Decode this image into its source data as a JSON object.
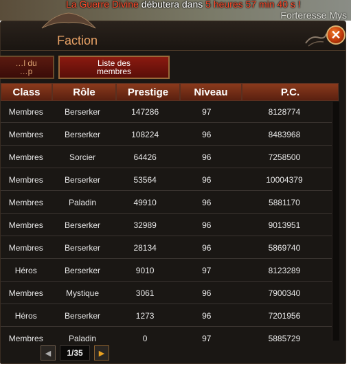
{
  "announcement": {
    "name": "La Guerre Divine",
    "text": "débutera dans",
    "time": "5 heures 57 min 40 s",
    "suffix": "!"
  },
  "background": {
    "place": "Forteresse Mys"
  },
  "window": {
    "title": "Faction",
    "close_symbol": "✕"
  },
  "tabs": [
    {
      "label": "…l du\n…p"
    },
    {
      "label": "Liste des\nmembres",
      "active": true
    }
  ],
  "table": {
    "columns": [
      "Class",
      "Rôle",
      "Prestige",
      "Niveau",
      "P.C."
    ],
    "rows": [
      [
        "Membres",
        "Berserker",
        "147286",
        "97",
        "8128774"
      ],
      [
        "Membres",
        "Berserker",
        "108224",
        "96",
        "8483968"
      ],
      [
        "Membres",
        "Sorcier",
        "64426",
        "96",
        "7258500"
      ],
      [
        "Membres",
        "Berserker",
        "53564",
        "96",
        "10004379"
      ],
      [
        "Membres",
        "Paladin",
        "49910",
        "96",
        "5881170"
      ],
      [
        "Membres",
        "Berserker",
        "32989",
        "96",
        "9013951"
      ],
      [
        "Membres",
        "Berserker",
        "28134",
        "96",
        "5869740"
      ],
      [
        "Héros",
        "Berserker",
        "9010",
        "97",
        "8123289"
      ],
      [
        "Membres",
        "Mystique",
        "3061",
        "96",
        "7900340"
      ],
      [
        "Héros",
        "Berserker",
        "1273",
        "96",
        "7201956"
      ],
      [
        "Membres",
        "Paladin",
        "0",
        "97",
        "5885729"
      ]
    ]
  },
  "pager": {
    "page": "1/35",
    "prev_icon": "◀",
    "next_icon": "▶"
  },
  "colors": {
    "accent": "#e8a266",
    "header": "#8a3a1c",
    "panel": "#1a1714"
  }
}
